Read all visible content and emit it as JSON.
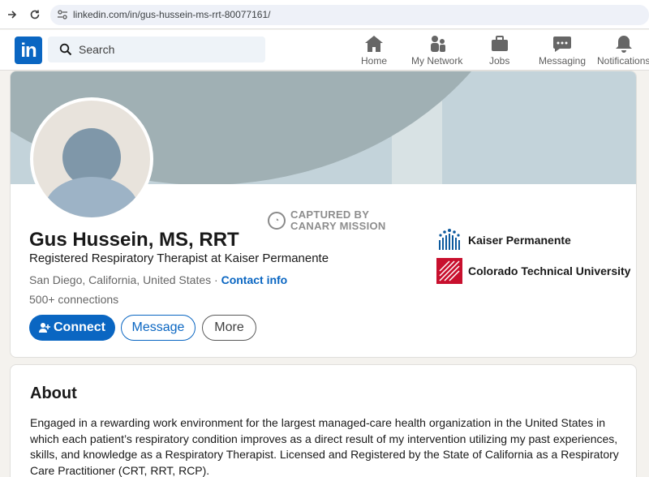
{
  "browser": {
    "url": "linkedin.com/in/gus-hussein-ms-rrt-80077161/"
  },
  "header": {
    "logo_text": "in",
    "search_placeholder": "Search",
    "nav": [
      {
        "label": "Home",
        "icon": "home-icon"
      },
      {
        "label": "My Network",
        "icon": "network-icon"
      },
      {
        "label": "Jobs",
        "icon": "jobs-icon"
      },
      {
        "label": "Messaging",
        "icon": "messaging-icon"
      },
      {
        "label": "Notifications",
        "icon": "bell-icon"
      }
    ]
  },
  "watermark": {
    "line1": "CAPTURED BY",
    "line2": "CANARY MISSION"
  },
  "profile": {
    "name": "Gus Hussein, MS, RRT",
    "headline": "Registered Respiratory Therapist at Kaiser Permanente",
    "location": "San Diego, California, United States",
    "separator": " · ",
    "contact_link": "Contact info",
    "connections": "500+ connections",
    "buttons": {
      "connect": "Connect",
      "message": "Message",
      "more": "More"
    },
    "organizations": [
      {
        "name": "Kaiser Permanente",
        "logo": "kaiser-permanente-logo",
        "color": "#0d5a9e"
      },
      {
        "name": "Colorado Technical University",
        "logo": "ctu-logo",
        "color": "#c8102e"
      }
    ]
  },
  "about": {
    "title": "About",
    "text": "Engaged in a rewarding work environment for the largest managed-care health organization in the United States in which each patient’s respiratory condition improves as a direct result of my intervention utilizing my past experiences, skills, and knowledge as a Respiratory Therapist. Licensed and Registered by the State of California as a Respiratory Care Practitioner (CRT, RRT, RCP)."
  },
  "colors": {
    "brand": "#0a66c2",
    "background": "#f4f2ee"
  }
}
